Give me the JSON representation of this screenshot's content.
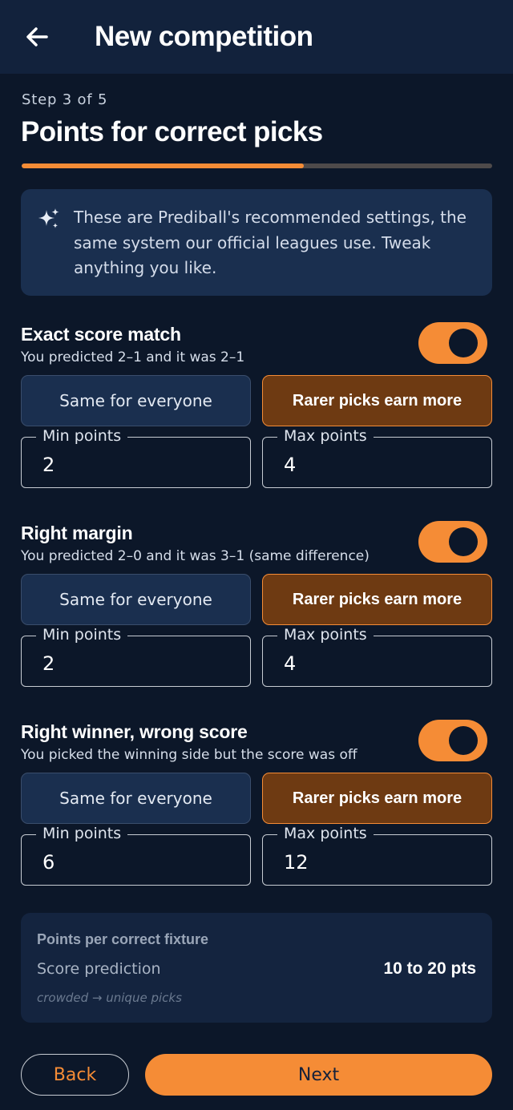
{
  "header": {
    "title": "New competition",
    "back_icon": "arrow-left-icon"
  },
  "step": {
    "label": "Step 3 of 5",
    "progress": 0.6
  },
  "page_title": "Points for correct picks",
  "info": {
    "icon": "sparkles-icon",
    "text": "These are Prediball's recommended settings, the same system our official leagues use. Tweak anything you like."
  },
  "sections": [
    {
      "title": "Exact score match",
      "subtitle": "You predicted 2–1 and it was 2–1",
      "enabled": true,
      "option_equal": "Same for everyone",
      "option_rarer": "Rarer picks earn more",
      "selected_option": "Rarer picks earn more",
      "min_label": "Min points",
      "min_value": "2",
      "max_label": "Max points",
      "max_value": "4"
    },
    {
      "title": "Right margin",
      "subtitle": "You predicted 2–0 and it was 3–1 (same difference)",
      "enabled": true,
      "option_equal": "Same for everyone",
      "option_rarer": "Rarer picks earn more",
      "selected_option": "Rarer picks earn more",
      "min_label": "Min points",
      "min_value": "2",
      "max_label": "Max points",
      "max_value": "4"
    },
    {
      "title": "Right winner, wrong score",
      "subtitle": "You picked the winning side but the score was off",
      "enabled": true,
      "option_equal": "Same for everyone",
      "option_rarer": "Rarer picks earn more",
      "selected_option": "Rarer picks earn more",
      "min_label": "Min points",
      "min_value": "6",
      "max_label": "Max points",
      "max_value": "12"
    }
  ],
  "summary": {
    "title": "Points per correct fixture",
    "label": "Score prediction",
    "value": "10 to 20 pts",
    "caption": "crowded → unique picks"
  },
  "footer": {
    "back_label": "Back",
    "next_label": "Next"
  },
  "colors": {
    "accent": "#f58c36",
    "background": "#0c1729",
    "card": "#1a2f4f",
    "selected_bg": "#6e3a12"
  }
}
